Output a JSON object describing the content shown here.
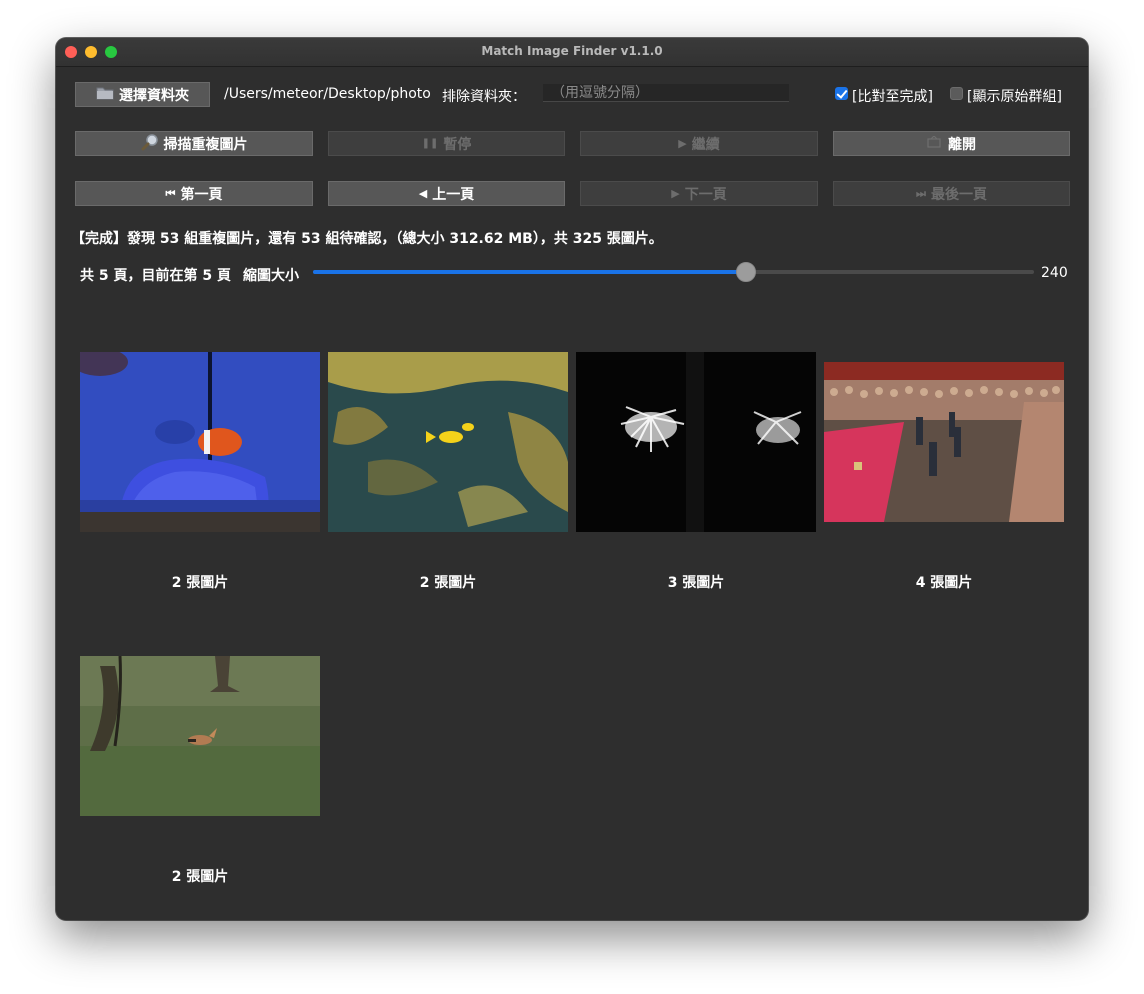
{
  "window": {
    "title": "Match Image Finder v1.1.0"
  },
  "toolbar": {
    "select_folder_label": "選擇資料夾",
    "folder_path": "/Users/meteor/Desktop/photo",
    "exclude_label": "排除資料夾：",
    "exclude_placeholder": "（用逗號分隔）",
    "compare_to_end_label": "[比對至完成]",
    "compare_to_end_checked": true,
    "show_original_groups_label": "[顯示原始群組]",
    "show_original_groups_checked": false
  },
  "actions": {
    "scan_label": "掃描重複圖片",
    "pause_label": "暫停",
    "resume_label": "繼續",
    "exit_label": "離開"
  },
  "pager": {
    "first_label": "第一頁",
    "prev_label": "上一頁",
    "next_label": "下一頁",
    "last_label": "最後一頁"
  },
  "status": {
    "message": "【完成】發現 53 組重複圖片，還有 53 組待確認，（總大小 312.62 MB），共 325 張圖片。",
    "page_info": "共 5 頁，目前在第 5 頁",
    "thumb_size_label": "縮圖大小",
    "thumb_size_value": "240",
    "thumb_size_fraction": 0.6
  },
  "groups": [
    {
      "caption": "2 張圖片",
      "subject": "clownfish aquarium"
    },
    {
      "caption": "2 張圖片",
      "subject": "yellow fish among rocks"
    },
    {
      "caption": "3 張圖片",
      "subject": "fireworks at night"
    },
    {
      "caption": "4 張圖片",
      "subject": "honor guard ceremony crowd"
    },
    {
      "caption": "2 張圖片",
      "subject": "hoopoe bird on grass"
    }
  ],
  "colors": {
    "window_bg": "#2e2e2e",
    "accent": "#1a73e8",
    "button_bg": "#575757",
    "button_disabled_text": "#6d6d6d"
  }
}
